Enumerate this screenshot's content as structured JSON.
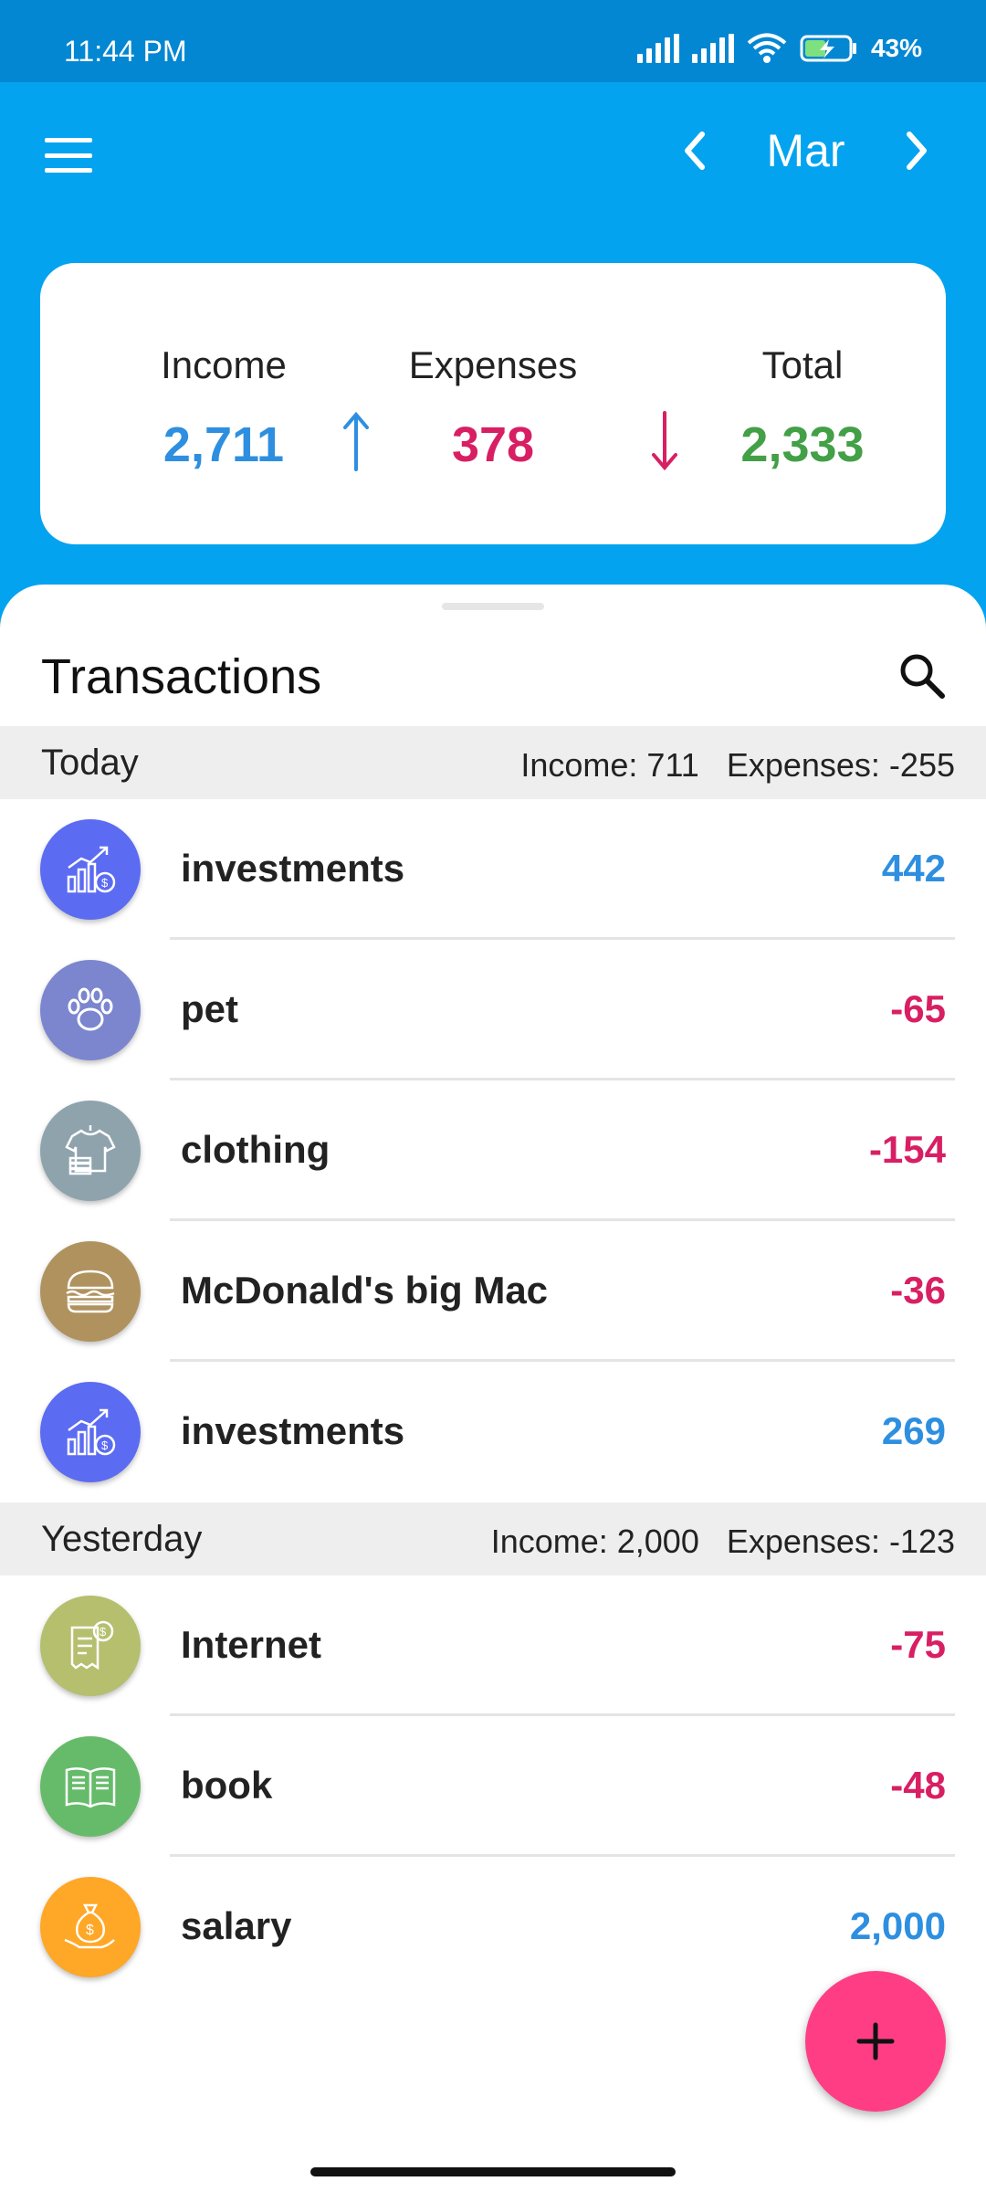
{
  "status_bar": {
    "time": "11:44 PM",
    "battery": "43%"
  },
  "header": {
    "month": "Mar"
  },
  "summary": {
    "income_label": "Income",
    "income_value": "2,711",
    "expenses_label": "Expenses",
    "expenses_value": "378",
    "total_label": "Total",
    "total_value": "2,333"
  },
  "transactions": {
    "title": "Transactions",
    "groups": [
      {
        "day": "Today",
        "totals": "Income: 711   Expenses: -255",
        "items": [
          {
            "name": "investments",
            "amount": "442",
            "type": "income",
            "icon": "investments-icon",
            "color": "#5B6BF2"
          },
          {
            "name": "pet",
            "amount": "-65",
            "type": "expense",
            "icon": "paw-icon",
            "color": "#7B86CF"
          },
          {
            "name": "clothing",
            "amount": "-154",
            "type": "expense",
            "icon": "shirt-icon",
            "color": "#8FA3AD"
          },
          {
            "name": "McDonald's big Mac",
            "amount": "-36",
            "type": "expense",
            "icon": "burger-icon",
            "color": "#B0925E"
          },
          {
            "name": "investments",
            "amount": "269",
            "type": "income",
            "icon": "investments-icon",
            "color": "#5B6BF2"
          }
        ]
      },
      {
        "day": "Yesterday",
        "totals": "Income: 2,000   Expenses: -123",
        "items": [
          {
            "name": "Internet",
            "amount": "-75",
            "type": "expense",
            "icon": "bill-icon",
            "color": "#B5BF6E"
          },
          {
            "name": "book",
            "amount": "-48",
            "type": "expense",
            "icon": "book-icon",
            "color": "#66BB6A"
          },
          {
            "name": "salary",
            "amount": "2,000",
            "type": "income",
            "icon": "money-bag-icon",
            "color": "#FFA726"
          }
        ]
      }
    ]
  },
  "colors": {
    "primary": "#04A3EF",
    "income": "#2E8FE0",
    "expense": "#D81F63",
    "total": "#43A047",
    "fab": "#FF3D84"
  }
}
